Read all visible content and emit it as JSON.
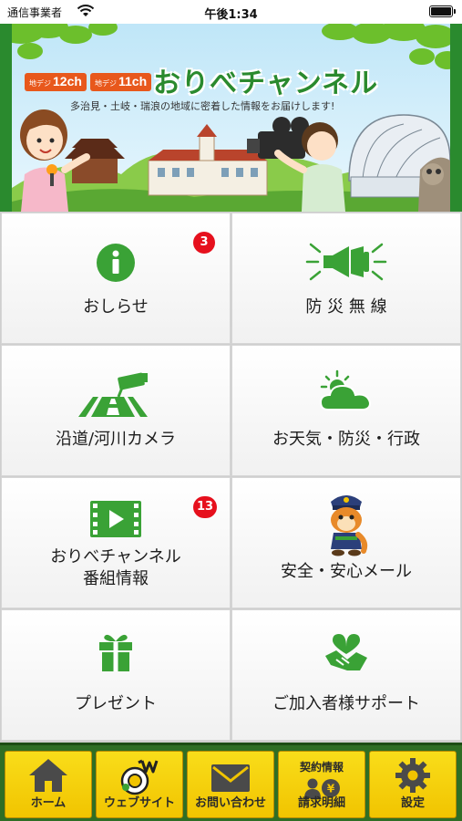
{
  "status_bar": {
    "carrier": "通信事業者",
    "time": "午後1:34"
  },
  "banner": {
    "channel_badges": [
      {
        "prefix": "地デジ",
        "channel": "12ch"
      },
      {
        "prefix": "地デジ",
        "channel": "11ch"
      }
    ],
    "title": "おりべチャンネル",
    "subtitle": "多治見・土岐・瑞浪の地域に密着した情報をお届けします!"
  },
  "menu": {
    "items": [
      {
        "label": "おしらせ",
        "icon": "info-icon",
        "badge": "3"
      },
      {
        "label": "防 災 無 線",
        "icon": "loudspeaker-icon",
        "badge": ""
      },
      {
        "label": "沿道/河川カメラ",
        "icon": "road-camera-icon",
        "badge": ""
      },
      {
        "label": "お天気・防災・行政",
        "icon": "sun-cloud-icon",
        "badge": ""
      },
      {
        "label": "おりべチャンネル",
        "label2": "番組情報",
        "icon": "video-icon",
        "badge": "13"
      },
      {
        "label": "安全・安心メール",
        "icon": "police-mascot-icon",
        "badge": ""
      },
      {
        "label": "プレゼント",
        "icon": "gift-icon",
        "badge": ""
      },
      {
        "label": "ご加入者様サポート",
        "icon": "handshake-heart-icon",
        "badge": ""
      }
    ]
  },
  "tab_bar": {
    "tabs": [
      {
        "label": "ホーム",
        "icon": "home-icon"
      },
      {
        "label": "ウェブサイト",
        "icon": "website-logo-icon"
      },
      {
        "label": "お問い合わせ",
        "icon": "mail-icon"
      },
      {
        "top": "契約情報",
        "label": "請求明細",
        "icon": "contract-icon"
      },
      {
        "label": "設定",
        "icon": "gear-icon"
      }
    ]
  },
  "colors": {
    "brand_green": "#2a8a2e",
    "icon_green": "#3aa236",
    "badge_red": "#e6101d",
    "tab_yellow": "#f1c400",
    "tab_bar_bg": "#2f6e25"
  }
}
